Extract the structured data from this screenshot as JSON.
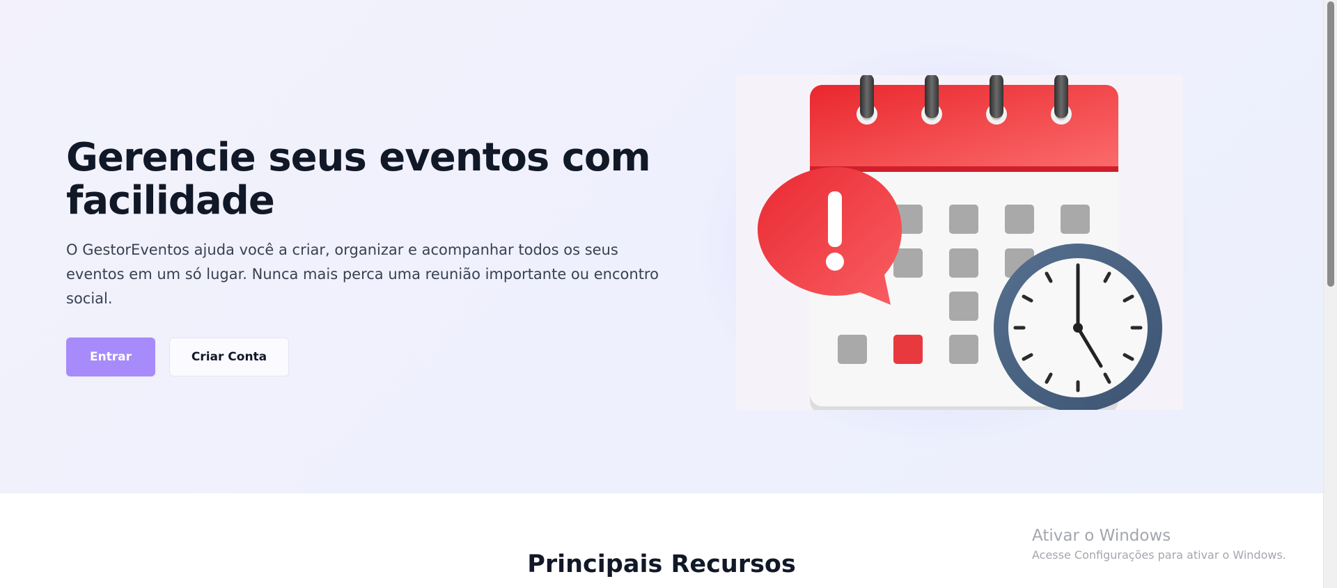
{
  "hero": {
    "title": "Gerencie seus eventos com facilidade",
    "description": "O GestorEventos ajuda você a criar, organizar e acompanhar todos os seus eventos em um só lugar. Nunca mais perca uma reunião importante ou encontro social.",
    "login_label": "Entrar",
    "signup_label": "Criar Conta",
    "illustration": "calendar-clock-alert-icon"
  },
  "features": {
    "title": "Principais Recursos"
  },
  "windows_watermark": {
    "title": "Ativar o Windows",
    "subtitle": "Acesse Configurações para ativar o Windows."
  },
  "colors": {
    "primary_button": "#a78bfa",
    "hero_background": "#eef0fd",
    "title_text": "#111827",
    "calendar_red": "#ef3b3f",
    "clock_ring": "#4a6282"
  }
}
